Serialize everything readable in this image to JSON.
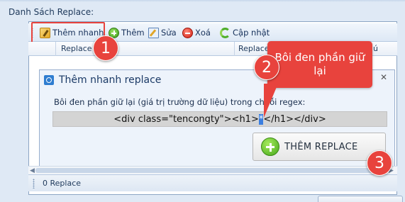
{
  "group": {
    "label": "Danh Sách Replace:"
  },
  "toolbar": {
    "quick_add": "Thêm nhanh",
    "add": "Thêm",
    "edit": "Sửa",
    "delete": "Xoá",
    "update": "Cập nhật"
  },
  "grid": {
    "columns": [
      "Replace T",
      "Replace Th",
      "ú"
    ]
  },
  "dialog": {
    "title": "Thêm nhanh replace",
    "description": "Bôi đen phần giữ lại (giá trị trường dữ liệu) trong chuỗi regex:",
    "code_before": "<div class=\"tencongty\"><h1>",
    "code_selected": "*",
    "code_after": "</h1></div>",
    "add_button": "THÊM REPLACE",
    "close_glyph": "✕"
  },
  "status": {
    "text": "0 Replace"
  },
  "annotations": {
    "badge1": "1",
    "badge2": "2",
    "badge3": "3",
    "callout": "Bôi đen phần giữ lại",
    "accent_color": "#e8433d"
  }
}
